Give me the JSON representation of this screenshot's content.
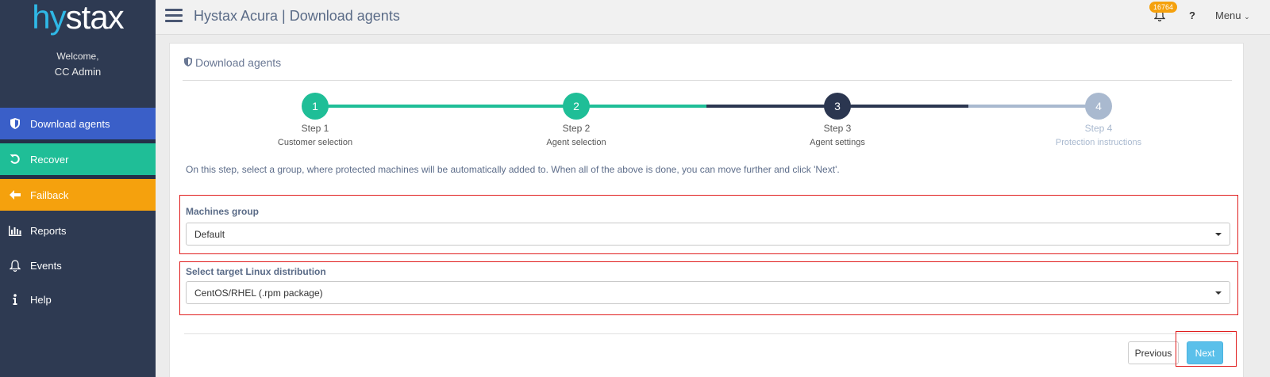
{
  "sidebar": {
    "logo": {
      "part1": "hy",
      "part2": "stax"
    },
    "welcome": "Welcome,",
    "user": "CC Admin",
    "items": [
      {
        "label": "Download agents",
        "icon": "shield-icon"
      },
      {
        "label": "Recover",
        "icon": "undo-icon"
      },
      {
        "label": "Failback",
        "icon": "arrow-left-icon"
      },
      {
        "label": "Reports",
        "icon": "bar-chart-icon"
      },
      {
        "label": "Events",
        "icon": "bell-icon"
      },
      {
        "label": "Help",
        "icon": "info-icon"
      }
    ]
  },
  "header": {
    "title": "Hystax Acura | Download agents",
    "notification_count": "16764",
    "help_label": "?",
    "menu_label": "Menu"
  },
  "card": {
    "title": "Download agents",
    "steps": [
      {
        "number": "1",
        "label": "Step 1",
        "sub": "Customer selection",
        "state": "completed"
      },
      {
        "number": "2",
        "label": "Step 2",
        "sub": "Agent selection",
        "state": "completed"
      },
      {
        "number": "3",
        "label": "Step 3",
        "sub": "Agent settings",
        "state": "current"
      },
      {
        "number": "4",
        "label": "Step 4",
        "sub": "Protection instructions",
        "state": "pending"
      }
    ],
    "info": "On this step, select a group, where protected machines will be automatically added to. When all of the above is done, you can move further and click 'Next'.",
    "machines_group": {
      "label": "Machines group",
      "value": "Default"
    },
    "linux_distribution": {
      "label": "Select target Linux distribution",
      "value": "CentOS/RHEL (.rpm package)"
    },
    "buttons": {
      "previous": "Previous",
      "next": "Next"
    }
  },
  "colors": {
    "sidebar_bg": "#2e3a52",
    "active_nav": "#3a5fc8",
    "recover": "#1fbe97",
    "failback": "#f5a10d",
    "step_completed": "#1fbe97",
    "step_current": "#2b3650",
    "step_pending": "#a9b9cf",
    "next_button": "#5bc0ea",
    "highlight_border": "#e01e1e"
  }
}
